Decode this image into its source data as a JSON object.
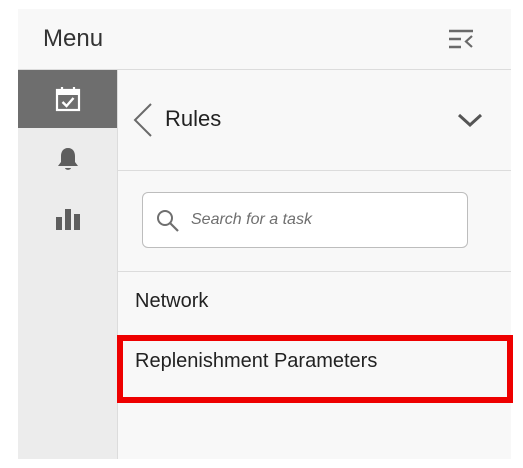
{
  "menu": {
    "title": "Menu",
    "collapse_icon": "collapse-menu-icon"
  },
  "rail": {
    "items": [
      {
        "icon": "calendar-check-icon",
        "active": true
      },
      {
        "icon": "bell-icon",
        "active": false
      },
      {
        "icon": "bar-chart-icon",
        "active": false
      }
    ]
  },
  "rules_bar": {
    "title": "Rules",
    "back_icon": "chevron-left-icon",
    "expand_icon": "chevron-down-icon"
  },
  "search": {
    "placeholder": "Search for a task",
    "value": "",
    "icon": "search-icon"
  },
  "list": {
    "items": [
      {
        "label": "Network"
      },
      {
        "label": "Replenishment Parameters",
        "highlighted": true
      }
    ]
  },
  "colors": {
    "panel_bg": "#f8f8f8",
    "rail_bg": "#ececec",
    "active_rail_bg": "#6e6e6e",
    "highlight": "#ee0000"
  }
}
